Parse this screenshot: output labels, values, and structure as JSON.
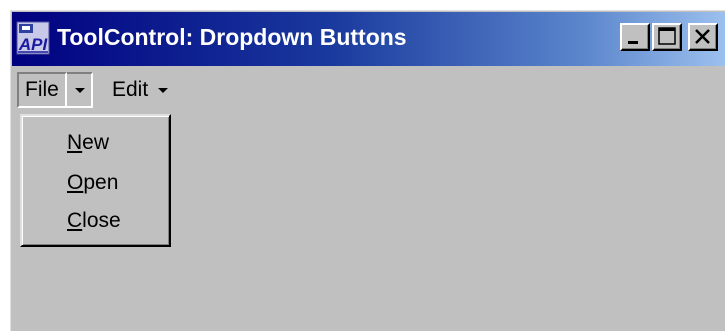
{
  "window": {
    "title": "ToolControl: Dropdown Buttons",
    "icon": "api-app-icon",
    "icon_text": "API",
    "controls": [
      "minimize",
      "maximize",
      "close"
    ]
  },
  "toolbar": {
    "file_label": "File",
    "edit_label": "Edit"
  },
  "file_menu": {
    "items": [
      {
        "label": "New",
        "mnemonic": "N"
      },
      {
        "label": "Open",
        "mnemonic": "O"
      },
      {
        "label": "Close",
        "mnemonic": "C"
      }
    ]
  },
  "colors": {
    "face": "#c0c0c0",
    "title_start": "#000080",
    "title_end": "#9cc0ee"
  }
}
